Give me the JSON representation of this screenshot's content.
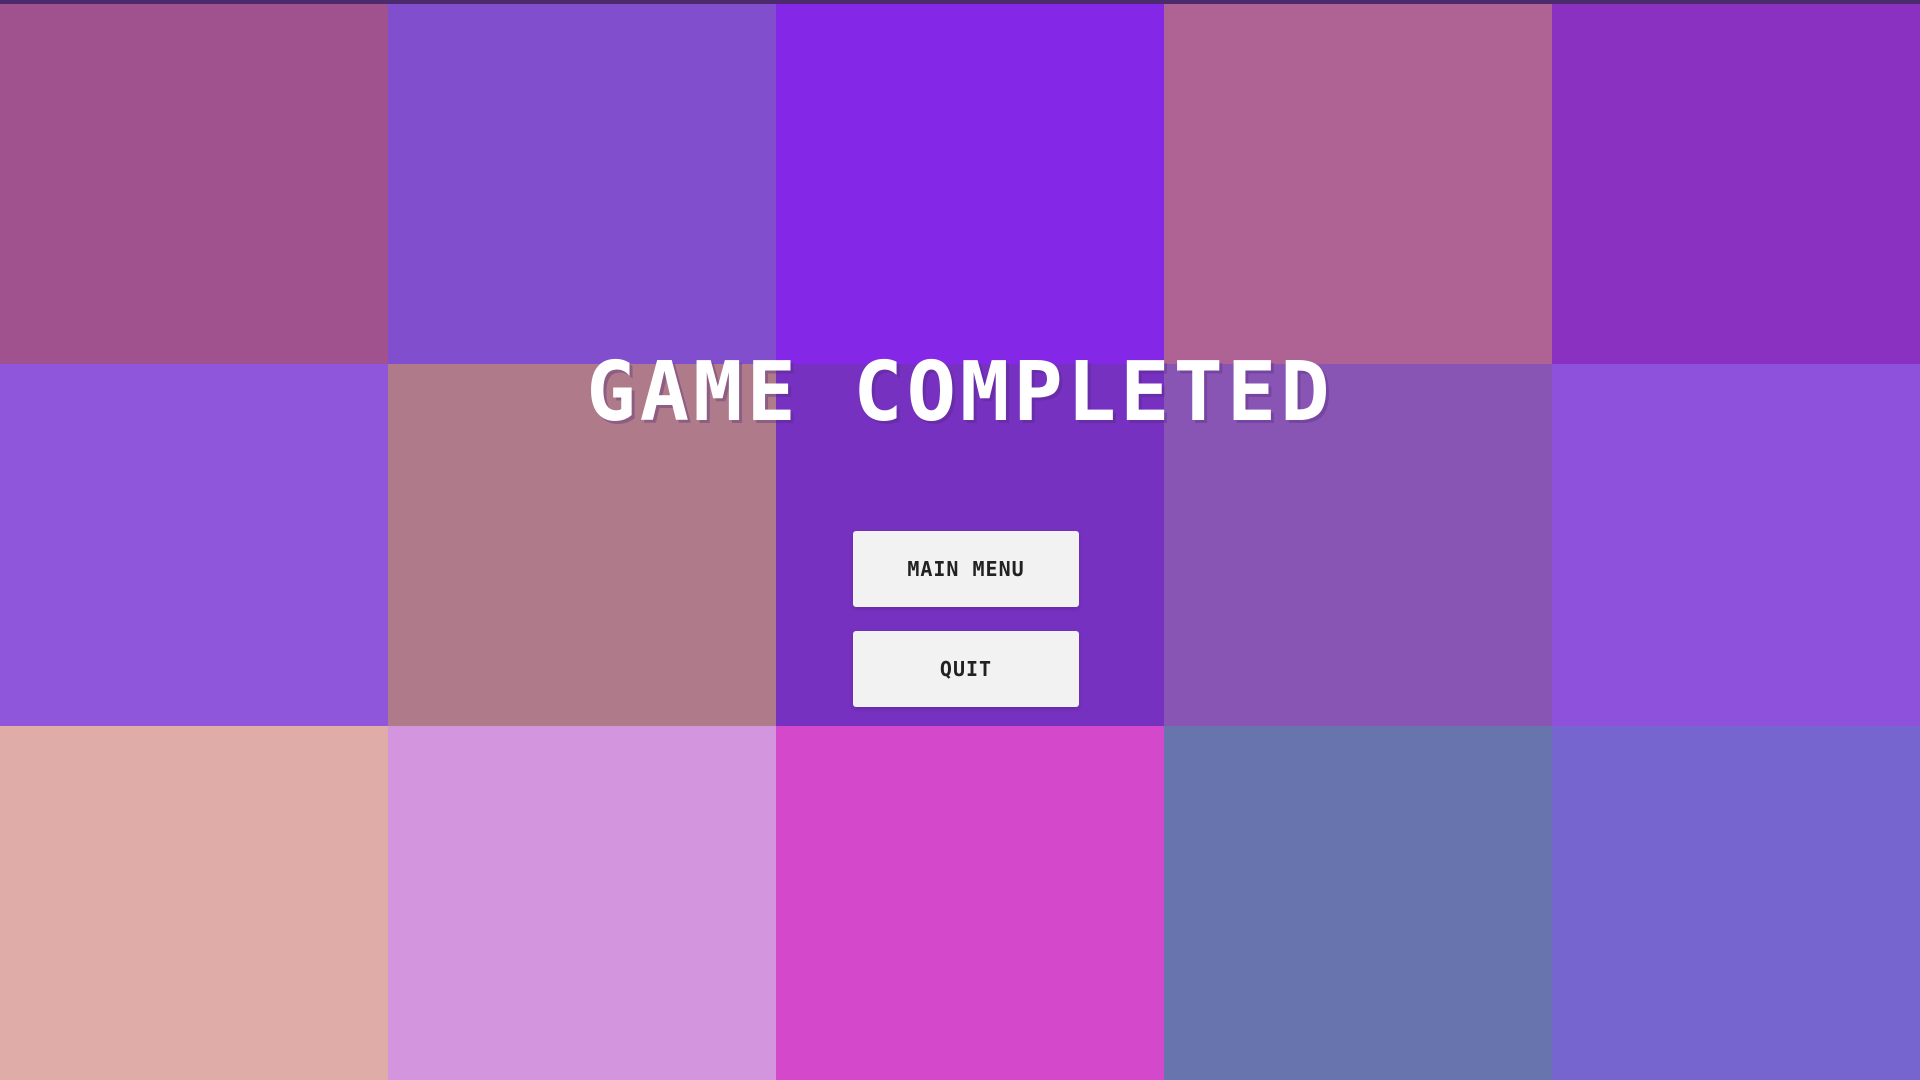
{
  "title": "GAME COMPLETED",
  "buttons": {
    "main_menu": "MAIN MENU",
    "quit": "QUIT"
  },
  "colors": {
    "title_text": "#ffffff",
    "button_bg": "#f2f2f2",
    "button_text": "#222222"
  },
  "tiles": [
    "#a0528e",
    "#814fce",
    "#8427e6",
    "#af6395",
    "#8a31c2",
    "#8f55db",
    "#af7a8a",
    "#7631c0",
    "#8955b5",
    "#8e51dc",
    "#e0aca7",
    "#d395dd",
    "#d448cb",
    "#6874ae",
    "#7765cf"
  ]
}
